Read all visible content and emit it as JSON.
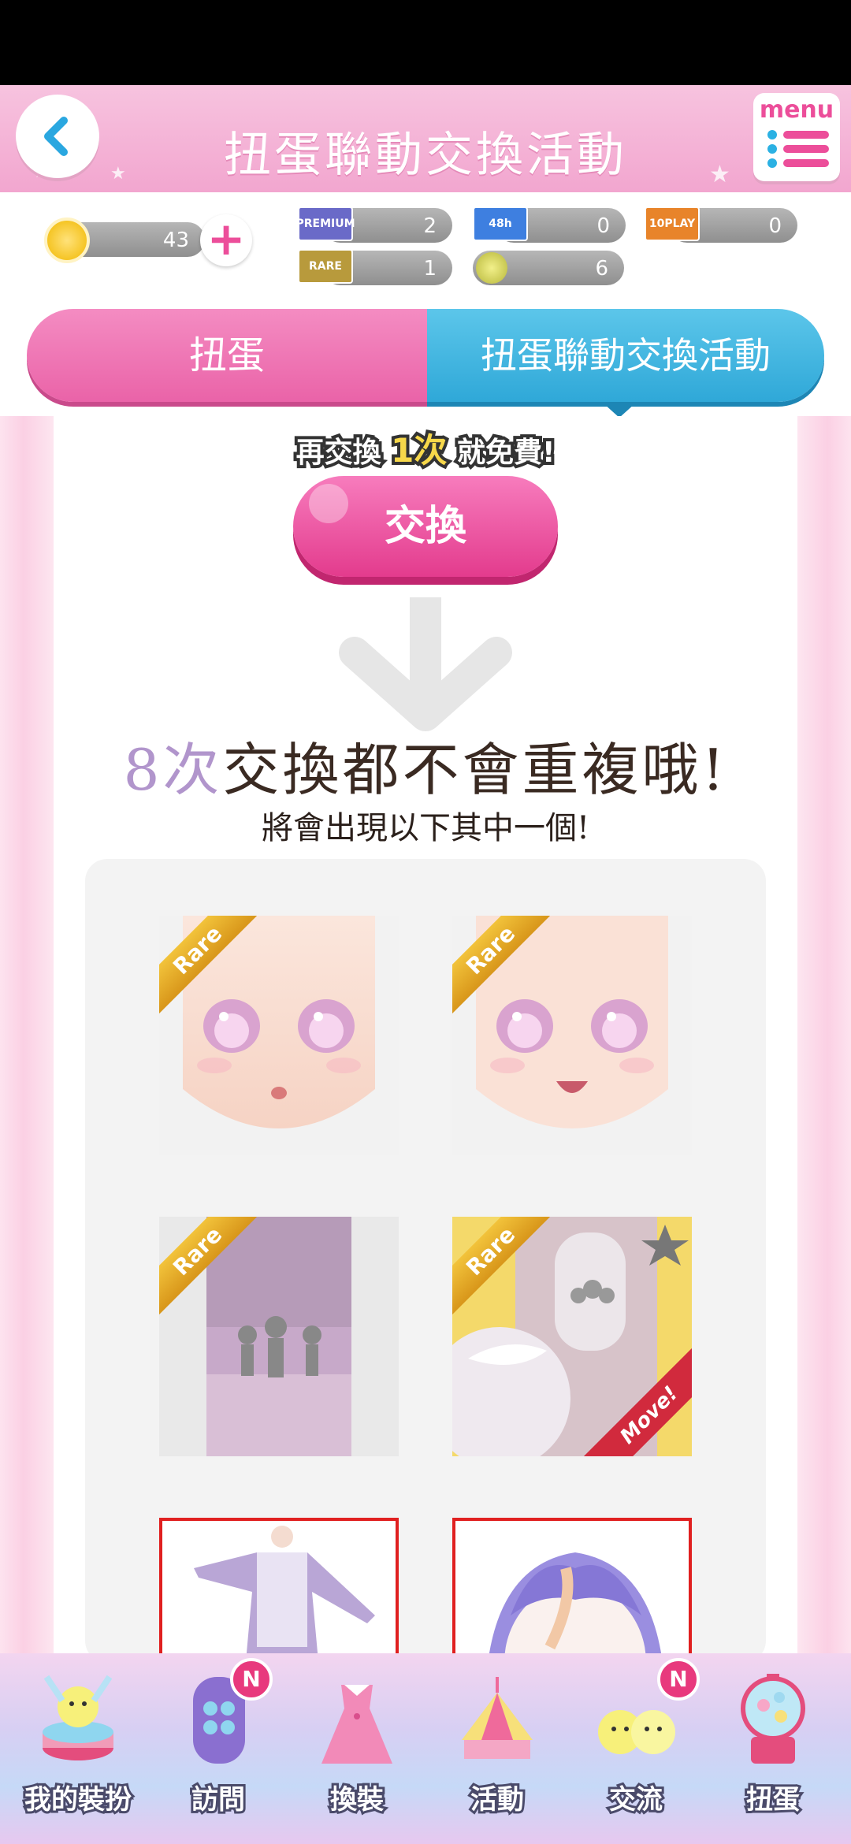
{
  "header": {
    "title": "扭蛋聯動交換活動",
    "menu_label": "menu"
  },
  "currency": {
    "coins": "43",
    "premium_ticket": {
      "label": "PREMIUM",
      "count": "2"
    },
    "ticket_48h": {
      "label": "48h",
      "count": "0"
    },
    "ticket_10play": {
      "label": "10PLAY",
      "count": "0"
    },
    "rare_ticket": {
      "label": "RARE",
      "count": "1"
    },
    "gem_item": {
      "count": "6"
    }
  },
  "tabs": [
    {
      "label": "扭蛋"
    },
    {
      "label": "扭蛋聯動交換活動"
    }
  ],
  "main": {
    "free_note_a": "再交換",
    "free_note_num": "1次",
    "free_note_b": "就免費!",
    "exchange_button": "交換",
    "headline_accent": "8次",
    "headline_rest": "交換都不會重複哦!",
    "subline": "將會出現以下其中一個!",
    "rare_label": "Rare",
    "move_label": "Move!"
  },
  "nav": [
    {
      "label": "我的裝扮"
    },
    {
      "label": "訪問",
      "badge": "N"
    },
    {
      "label": "換裝"
    },
    {
      "label": "活動"
    },
    {
      "label": "交流",
      "badge": "N"
    },
    {
      "label": "扭蛋"
    }
  ],
  "colors": {
    "header_pink": "#f2a6cf",
    "tab_pink": "#ea63a8",
    "tab_blue": "#2fa8d8",
    "exchange_pink": "#e33b8d",
    "accent_purple": "#b195cc"
  }
}
